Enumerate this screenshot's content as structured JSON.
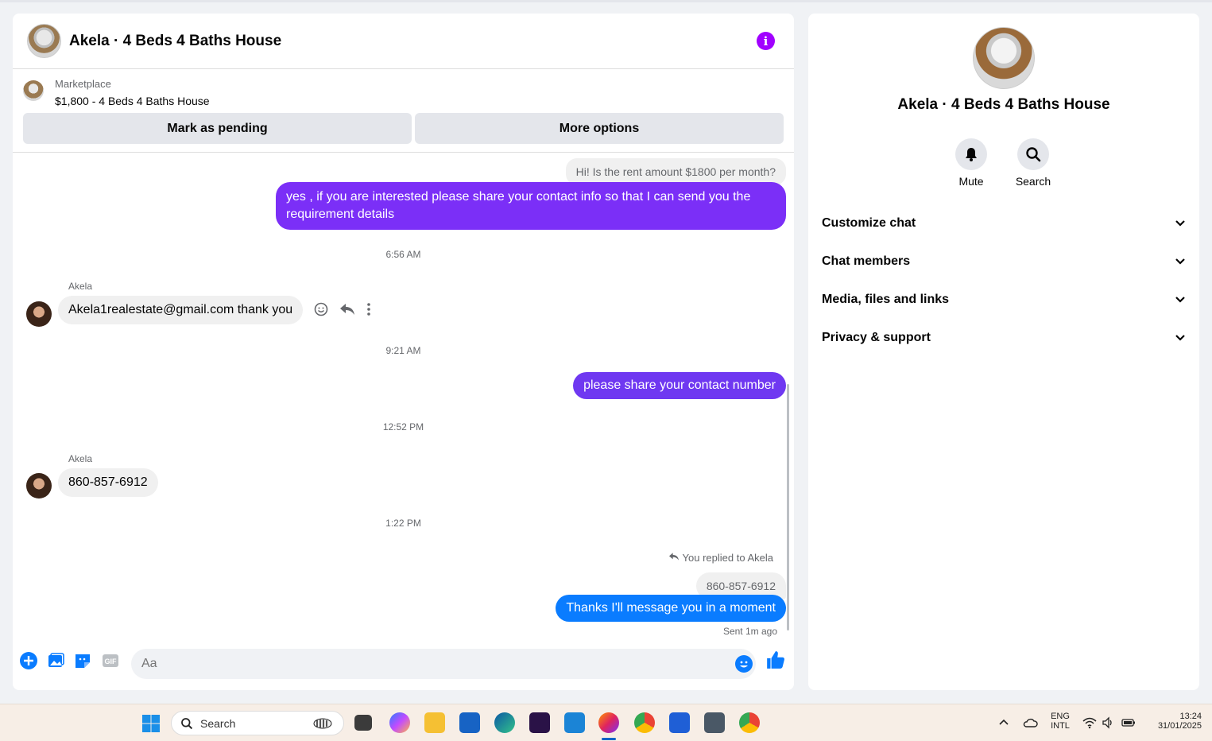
{
  "chat": {
    "title": "Akela · 4 Beds 4 Baths House",
    "marketplace_label": "Marketplace",
    "listing": "$1,800 - 4 Beds 4 Baths House",
    "mark_pending": "Mark as pending",
    "more_options": "More options"
  },
  "messages": {
    "m1_in": "Hi! Is the rent amount $1800 per month?",
    "m2_out_line1": "yes , if you are interested please share your contact info so that I can send you the",
    "m2_out_line2": "requirement details",
    "t1": "6:56 AM",
    "sender1": "Akela",
    "m3_in": "Akela1realestate@gmail.com thank you",
    "t2": "9:21 AM",
    "m4_out": "please share your contact number",
    "t3": "12:52 PM",
    "sender2": "Akela",
    "m5_in": "860-857-6912",
    "t4": "1:22 PM",
    "reply_note": "You replied to Akela",
    "quoted": "860-857-6912",
    "m6_out": "Thanks I'll message you in a moment",
    "sent_note": "Sent 1m ago"
  },
  "composer": {
    "placeholder": "Aa"
  },
  "details": {
    "title": "Akela · 4 Beds 4 Baths House",
    "mute": "Mute",
    "search": "Search",
    "sections": [
      "Customize chat",
      "Chat members",
      "Media, files and links",
      "Privacy & support"
    ]
  },
  "taskbar": {
    "search": "Search",
    "lang1": "ENG",
    "lang2": "INTL",
    "time": "13:24",
    "date": "31/01/2025"
  },
  "colors": {
    "accent": "#0a7cff",
    "purple": "#7b2ff7",
    "info": "#a100ff"
  }
}
